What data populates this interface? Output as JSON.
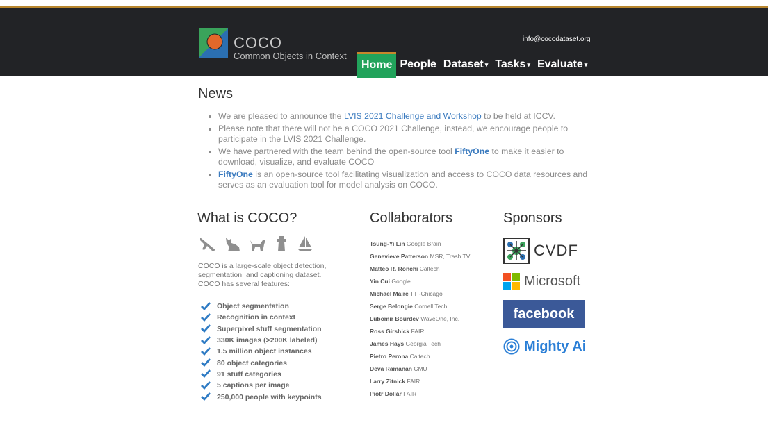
{
  "header": {
    "brand_title": "COCO",
    "brand_subtitle": "Common Objects in Context",
    "email": "info@cocodataset.org",
    "nav": [
      {
        "label": "Home",
        "active": true
      },
      {
        "label": "People"
      },
      {
        "label": "Dataset",
        "dropdown": true
      },
      {
        "label": "Tasks",
        "dropdown": true
      },
      {
        "label": "Evaluate",
        "dropdown": true
      }
    ]
  },
  "news": {
    "title": "News",
    "items": [
      {
        "pre": "We are pleased to announce the ",
        "link": "LVIS 2021 Challenge and Workshop",
        "post": " to be held at ICCV."
      },
      {
        "pre": "Please note that there will not be a COCO 2021 Challenge, instead, we encourage people to participate in the LVIS 2021 Challenge.",
        "link": "",
        "post": ""
      },
      {
        "pre": "We have partnered with the team behind the open-source tool ",
        "link": "FiftyOne",
        "post": " to make it easier to download, visualize, and evaluate COCO"
      },
      {
        "pre": "",
        "link": "FiftyOne",
        "post": " is an open-source tool facilitating visualization and access to COCO data resources and serves as an evaluation tool for model analysis on COCO."
      }
    ]
  },
  "what": {
    "title": "What is COCO?",
    "icons": [
      "airplane-icon",
      "cat-icon",
      "dog-icon",
      "fire-hydrant-icon",
      "sailboat-icon"
    ],
    "description": "COCO is a large-scale object detection, segmentation, and captioning dataset. COCO has several features:",
    "features": [
      "Object segmentation",
      "Recognition in context",
      "Superpixel stuff segmentation",
      "330K images (>200K labeled)",
      "1.5 million object instances",
      "80 object categories",
      "91 stuff categories",
      "5 captions per image",
      "250,000 people with keypoints"
    ]
  },
  "collaborators": {
    "title": "Collaborators",
    "people": [
      {
        "name": "Tsung-Yi Lin",
        "org": "Google Brain"
      },
      {
        "name": "Genevieve Patterson",
        "org": "MSR, Trash TV"
      },
      {
        "name": "Matteo R. Ronchi",
        "org": "Caltech"
      },
      {
        "name": "Yin Cui",
        "org": "Google"
      },
      {
        "name": "Michael Maire",
        "org": "TTI-Chicago"
      },
      {
        "name": "Serge Belongie",
        "org": "Cornell Tech"
      },
      {
        "name": "Lubomir Bourdev",
        "org": "WaveOne, Inc."
      },
      {
        "name": "Ross Girshick",
        "org": "FAIR"
      },
      {
        "name": "James Hays",
        "org": "Georgia Tech"
      },
      {
        "name": "Pietro Perona",
        "org": "Caltech"
      },
      {
        "name": "Deva Ramanan",
        "org": "CMU"
      },
      {
        "name": "Larry Zitnick",
        "org": "FAIR"
      },
      {
        "name": "Piotr Dollár",
        "org": "FAIR"
      }
    ]
  },
  "sponsors": {
    "title": "Sponsors",
    "cvdf": "CVDF",
    "microsoft": "Microsoft",
    "facebook": "facebook",
    "mighty": "Mighty Ai"
  },
  "colors": {
    "header_bg": "#222326",
    "nav_active": "#22a35b",
    "accent_orange": "#c8862b",
    "link_blue": "#3b7bbf",
    "check_blue": "#2e7bc4",
    "facebook_blue": "#3b5998"
  }
}
